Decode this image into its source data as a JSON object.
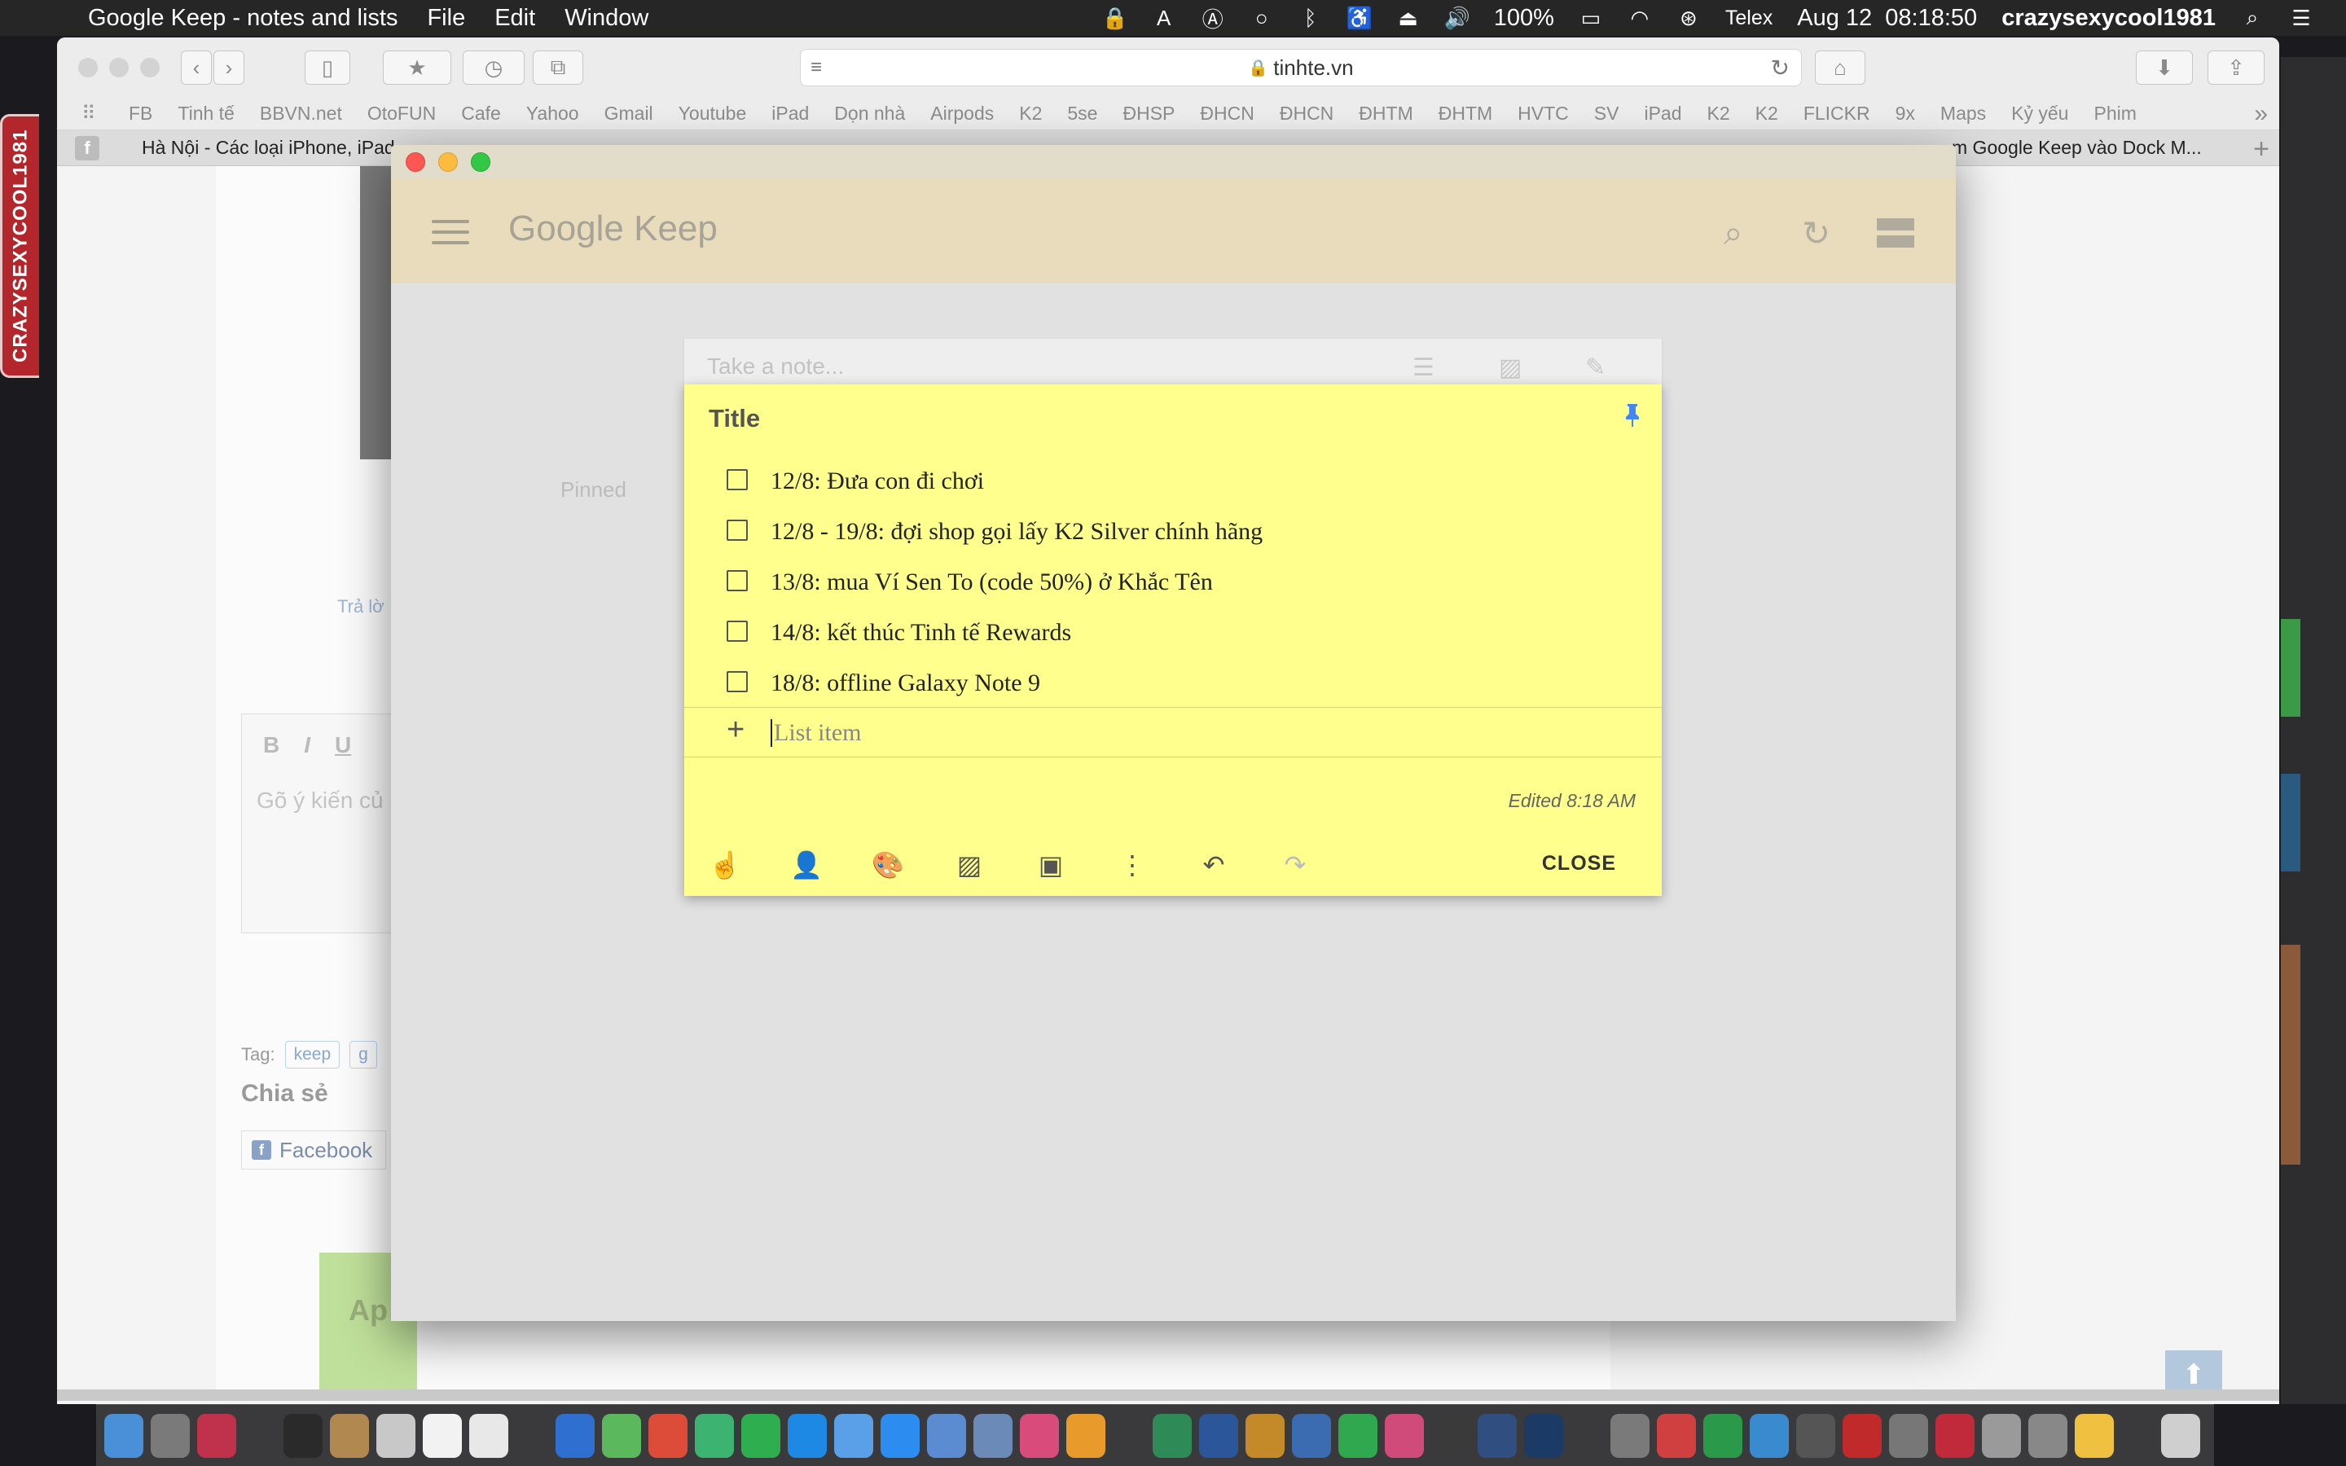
{
  "menubar": {
    "app": "Google Keep - notes and lists",
    "menus": [
      "File",
      "Edit",
      "Window"
    ],
    "battery": "100%",
    "input_method": "Telex",
    "clock": "Aug 12  08:18:50",
    "user": "crazysexycool1981"
  },
  "side_badge": "CRAZYSEXYCOOL1981",
  "safari": {
    "url": "tinhte.vn",
    "bookmarks": [
      "FB",
      "Tinh tế",
      "BBVN.net",
      "OtoFUN",
      "Cafe",
      "Yahoo",
      "Gmail",
      "Youtube",
      "iPad",
      "Dọn nhà",
      "Airpods",
      "K2",
      "5se",
      "ĐHSP",
      "ĐHCN",
      "ĐHCN",
      "ĐHTM",
      "ĐHTM",
      "HVTC",
      "SV",
      "iPad",
      "K2",
      "K2",
      "FLICKR",
      "9x",
      "Maps",
      "Kỷ yếu",
      "Phim"
    ],
    "tab_left": "Hà Nội - Các loại iPhone, iPad",
    "tab_right": "m Google Keep vào Dock M..."
  },
  "page": {
    "reply": "Trả lờ",
    "editor_placeholder": "Gõ ý kiến củ",
    "tag_label": "Tag:",
    "tags": [
      "keep",
      "g"
    ],
    "share_heading": "Chia sẻ",
    "facebook": "Facebook",
    "ad_text": "Ap"
  },
  "keep": {
    "logo": "Google Keep",
    "take_note": "Take a note...",
    "pinned": "Pinned",
    "note": {
      "title": "Title",
      "items": [
        "12/8: Đưa con đi chơi",
        "12/8 - 19/8: đợi shop gọi lấy K2 Silver chính hãng",
        "13/8: mua Ví Sen To (code 50%) ở Khắc Tên",
        "14/8: kết thúc Tinh tế Rewards",
        "18/8: offline Galaxy Note 9"
      ],
      "new_item_placeholder": "List item",
      "edited": "Edited 8:18 AM",
      "close": "CLOSE"
    }
  },
  "colors": {
    "note_bg": "#ffff8d",
    "keep_header": "#e8dcbc",
    "pin": "#4285f4"
  }
}
